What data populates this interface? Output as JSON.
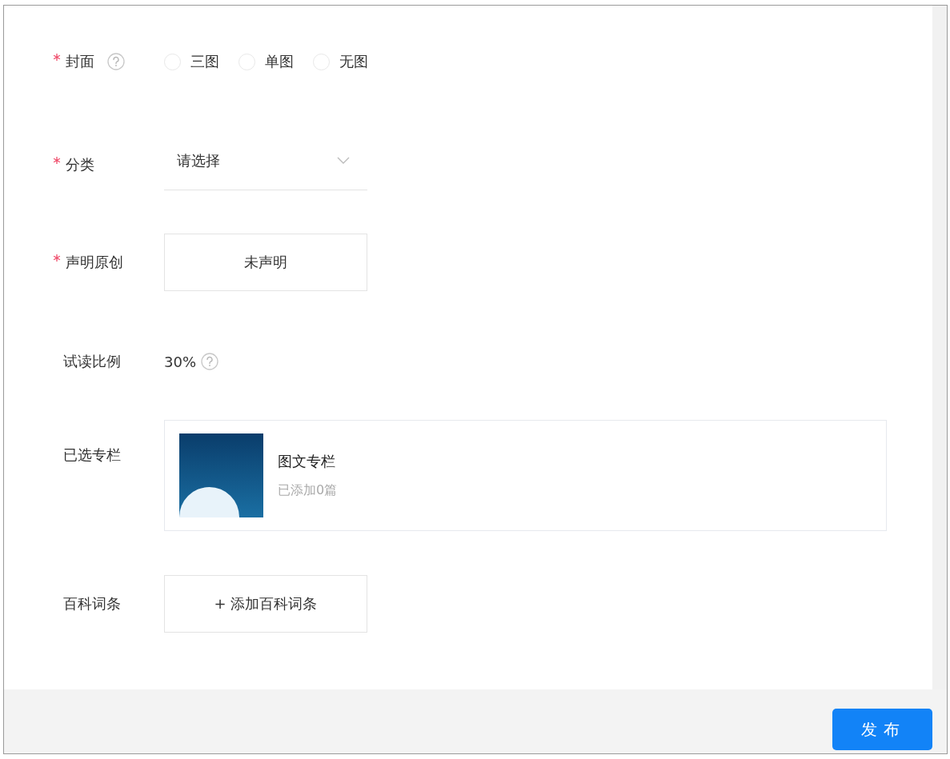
{
  "form": {
    "fields": [
      {
        "kind": "radio",
        "label": "封面",
        "required": true,
        "help": true,
        "options": [
          {
            "label": "三图",
            "selected": false
          },
          {
            "label": "单图",
            "selected": false
          },
          {
            "label": "无图",
            "selected": false
          }
        ]
      },
      {
        "kind": "select",
        "label": "分类",
        "required": true,
        "help": false,
        "placeholder": "请选择"
      },
      {
        "kind": "button",
        "label": "声明原创",
        "required": true,
        "help": false,
        "button": "未声明"
      },
      {
        "kind": "value",
        "label": "试读比例",
        "required": false,
        "help": true,
        "value": "30%"
      },
      {
        "kind": "column",
        "label": "已选专栏",
        "required": false,
        "help": false,
        "title": "图文专栏",
        "subtitle": "已添加0篇"
      },
      {
        "kind": "button",
        "label": "百科词条",
        "required": false,
        "help": false,
        "button": "+ 添加百科词条"
      }
    ]
  },
  "footer": {
    "publish": "发布"
  }
}
